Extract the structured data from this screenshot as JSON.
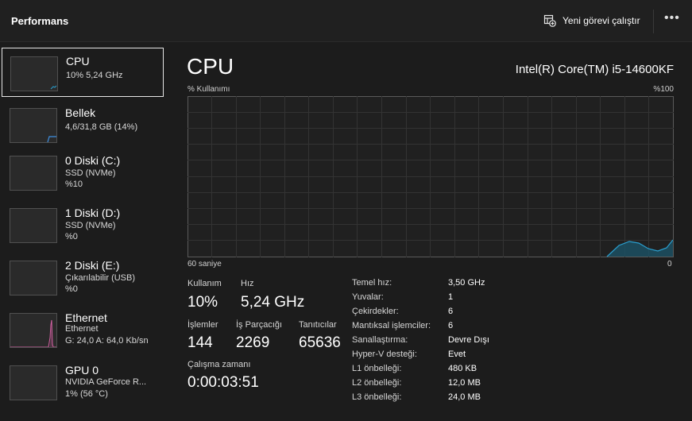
{
  "header": {
    "title": "Performans",
    "new_task_label": "Yeni görevi çalıştır",
    "more_label": "•••"
  },
  "sidebar": {
    "items": [
      {
        "title": "CPU",
        "line1": "10%  5,24 GHz",
        "line2": ""
      },
      {
        "title": "Bellek",
        "line1": "4,6/31,8 GB (14%)",
        "line2": ""
      },
      {
        "title": "0 Diski (C:)",
        "line1": "SSD (NVMe)",
        "line2": "%10"
      },
      {
        "title": "1 Diski (D:)",
        "line1": "SSD (NVMe)",
        "line2": "%0"
      },
      {
        "title": "2 Diski (E:)",
        "line1": "Çıkarılabilir (USB)",
        "line2": "%0"
      },
      {
        "title": "Ethernet",
        "line1": "Ethernet",
        "line2": "G: 24,0  A: 64,0 Kb/sn"
      },
      {
        "title": "GPU 0",
        "line1": "NVIDIA GeForce R...",
        "line2": "1%  (56 °C)"
      }
    ]
  },
  "main": {
    "heading": "CPU",
    "model": "Intel(R) Core(TM) i5-14600KF",
    "util_label": "% Kullanımı",
    "max_label": "%100",
    "time_left": "60 saniye",
    "time_right": "0"
  },
  "stats": {
    "usage_label": "Kullanım",
    "usage_value": "10%",
    "speed_label": "Hız",
    "speed_value": "5,24 GHz",
    "processes_label": "İşlemler",
    "processes_value": "144",
    "threads_label": "İş Parçacığı",
    "threads_value": "2269",
    "handles_label": "Tanıtıcılar",
    "handles_value": "65636",
    "uptime_label": "Çalışma zamanı",
    "uptime_value": "0:00:03:51"
  },
  "info": [
    {
      "key": "Temel hız:",
      "value": "3,50 GHz"
    },
    {
      "key": "Yuvalar:",
      "value": "1"
    },
    {
      "key": "Çekirdekler:",
      "value": "6"
    },
    {
      "key": "Mantıksal işlemciler:",
      "value": "6"
    },
    {
      "key": "Sanallaştırma:",
      "value": "Devre Dışı"
    },
    {
      "key": "Hyper-V desteği:",
      "value": "Evet"
    },
    {
      "key": "L1 önbelleği:",
      "value": "480 KB"
    },
    {
      "key": "L2 önbelleği:",
      "value": "12,0 MB"
    },
    {
      "key": "L3 önbelleği:",
      "value": "24,0 MB"
    }
  ],
  "colors": {
    "cpu_line": "#2a9fcf",
    "memory_line": "#3f8fe0",
    "ethernet_line": "#d05fa0"
  },
  "icons": {
    "new_task": "new-task-icon",
    "more": "more-options-icon"
  }
}
